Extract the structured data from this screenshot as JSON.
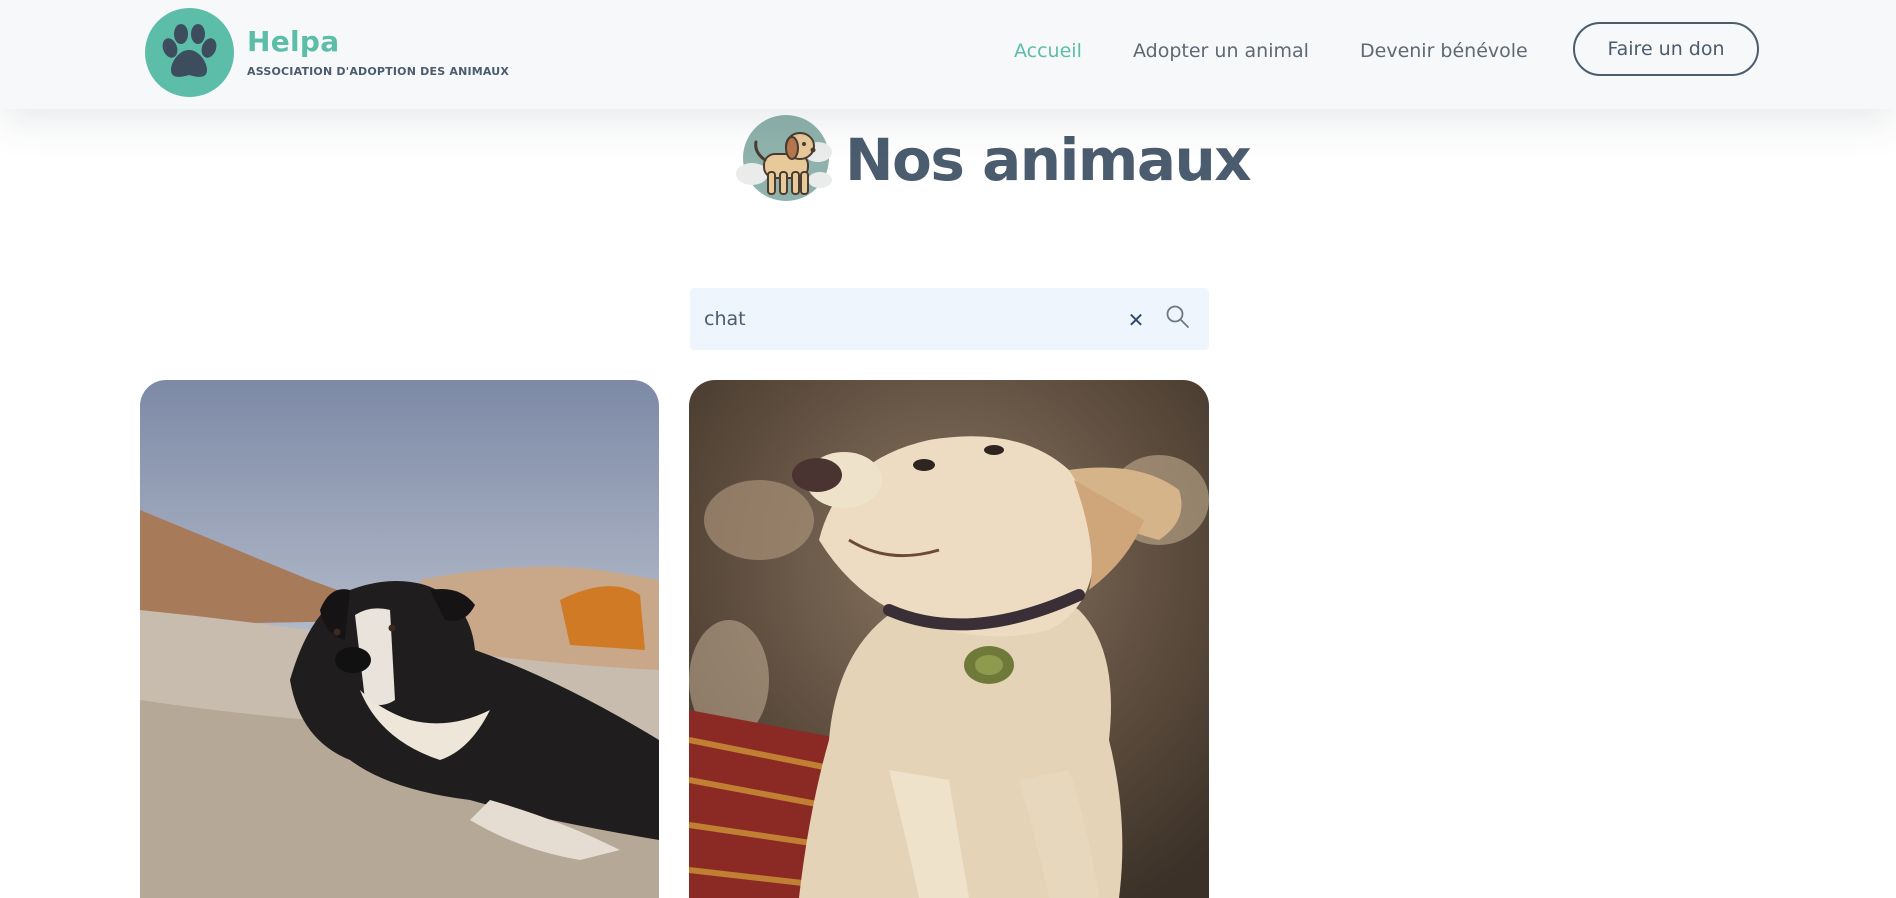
{
  "header": {
    "brand_name": "Helpa",
    "brand_tagline": "ASSOCIATION D'ADOPTION DES ANIMAUX",
    "nav": [
      {
        "label": "Accueil",
        "active": true
      },
      {
        "label": "Adopter un animal",
        "active": false
      },
      {
        "label": "Devenir bénévole",
        "active": false
      }
    ],
    "donate_label": "Faire un don"
  },
  "main": {
    "title": "Nos animaux",
    "search": {
      "value": "chat",
      "clear_icon": "close-icon",
      "search_icon": "search-icon"
    },
    "cards": [
      {
        "image": "black-white-dog-lying-on-sand"
      },
      {
        "image": "white-labrador-sitting"
      }
    ]
  },
  "colors": {
    "accent": "#5cbda8",
    "text_dark": "#4a5c6e",
    "header_bg": "#f6f8fa",
    "search_bg": "#eef5fc"
  }
}
